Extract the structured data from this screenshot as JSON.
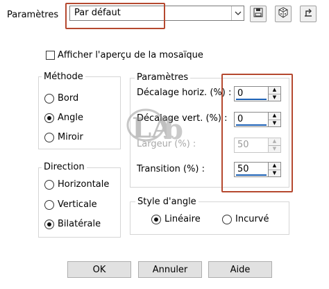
{
  "preset": {
    "label": "Paramètres",
    "value": "Par défaut"
  },
  "toolbar": {
    "save_icon": "save-icon",
    "random_icon": "dice-icon",
    "reset_icon": "reset-icon"
  },
  "preview_checkbox": {
    "label": "Afficher l'aperçu de la mosaïque",
    "checked": false
  },
  "methode": {
    "title": "Méthode",
    "options": [
      {
        "label": "Bord",
        "selected": false
      },
      {
        "label": "Angle",
        "selected": true
      },
      {
        "label": "Miroir",
        "selected": false
      }
    ]
  },
  "direction": {
    "title": "Direction",
    "options": [
      {
        "label": "Horizontale",
        "selected": false
      },
      {
        "label": "Verticale",
        "selected": false
      },
      {
        "label": "Bilatérale",
        "selected": true
      }
    ]
  },
  "parametres": {
    "title": "Paramètres",
    "fields": [
      {
        "label": "Décalage horiz. (%) :",
        "value": "0",
        "enabled": true
      },
      {
        "label": "Décalage vert. (%) :",
        "value": "0",
        "enabled": true
      },
      {
        "label": "Largeur (%) :",
        "value": "50",
        "enabled": false
      },
      {
        "label": "Transition (%) :",
        "value": "50",
        "enabled": true
      }
    ]
  },
  "style_angle": {
    "title": "Style d'angle",
    "options": [
      {
        "label": "Linéaire",
        "selected": true
      },
      {
        "label": "Incurvé",
        "selected": false
      }
    ]
  },
  "buttons": {
    "ok": "OK",
    "cancel": "Annuler",
    "help": "Aide"
  },
  "colors": {
    "highlight": "#b5482f",
    "spin_bar": "#1a5fb4"
  }
}
